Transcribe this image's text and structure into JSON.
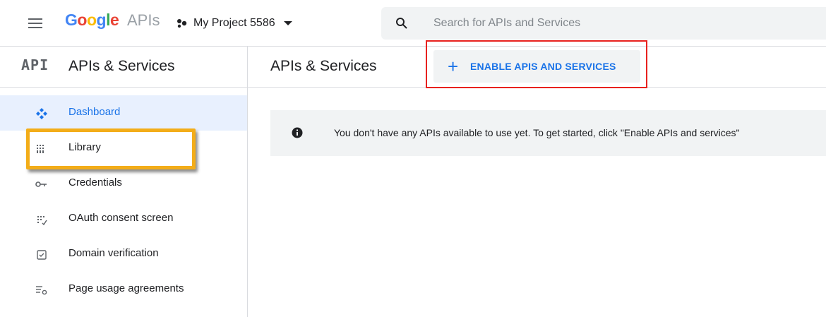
{
  "topbar": {
    "logo": {
      "letters": [
        "G",
        "o",
        "o",
        "g",
        "l",
        "e"
      ],
      "suffix": "APIs"
    },
    "project_name": "My Project 5586",
    "search": {
      "placeholder": "Search for APIs and Services",
      "value": ""
    }
  },
  "header": {
    "api_badge": "API",
    "section_title": "APIs & Services",
    "page_title": "APIs & Services",
    "enable_button": {
      "icon": "+",
      "label": "ENABLE APIS AND SERVICES"
    }
  },
  "sidebar": {
    "items": [
      {
        "label": "Dashboard",
        "icon": "dashboard-icon",
        "active": true
      },
      {
        "label": "Library",
        "icon": "library-icon",
        "active": false
      },
      {
        "label": "Credentials",
        "icon": "key-icon",
        "active": false
      },
      {
        "label": "OAuth consent screen",
        "icon": "oauth-icon",
        "active": false
      },
      {
        "label": "Domain verification",
        "icon": "domain-check-icon",
        "active": false
      },
      {
        "label": "Page usage agreements",
        "icon": "settings-list-icon",
        "active": false
      }
    ]
  },
  "banner": {
    "text": "You don't have any APIs available to use yet. To get started, click \"Enable APIs and services\""
  },
  "colors": {
    "accent": "#1a73e8",
    "active_bg": "#e8f0fe",
    "highlight_red": "#e8211e",
    "highlight_yellow": "#f3ad19"
  }
}
